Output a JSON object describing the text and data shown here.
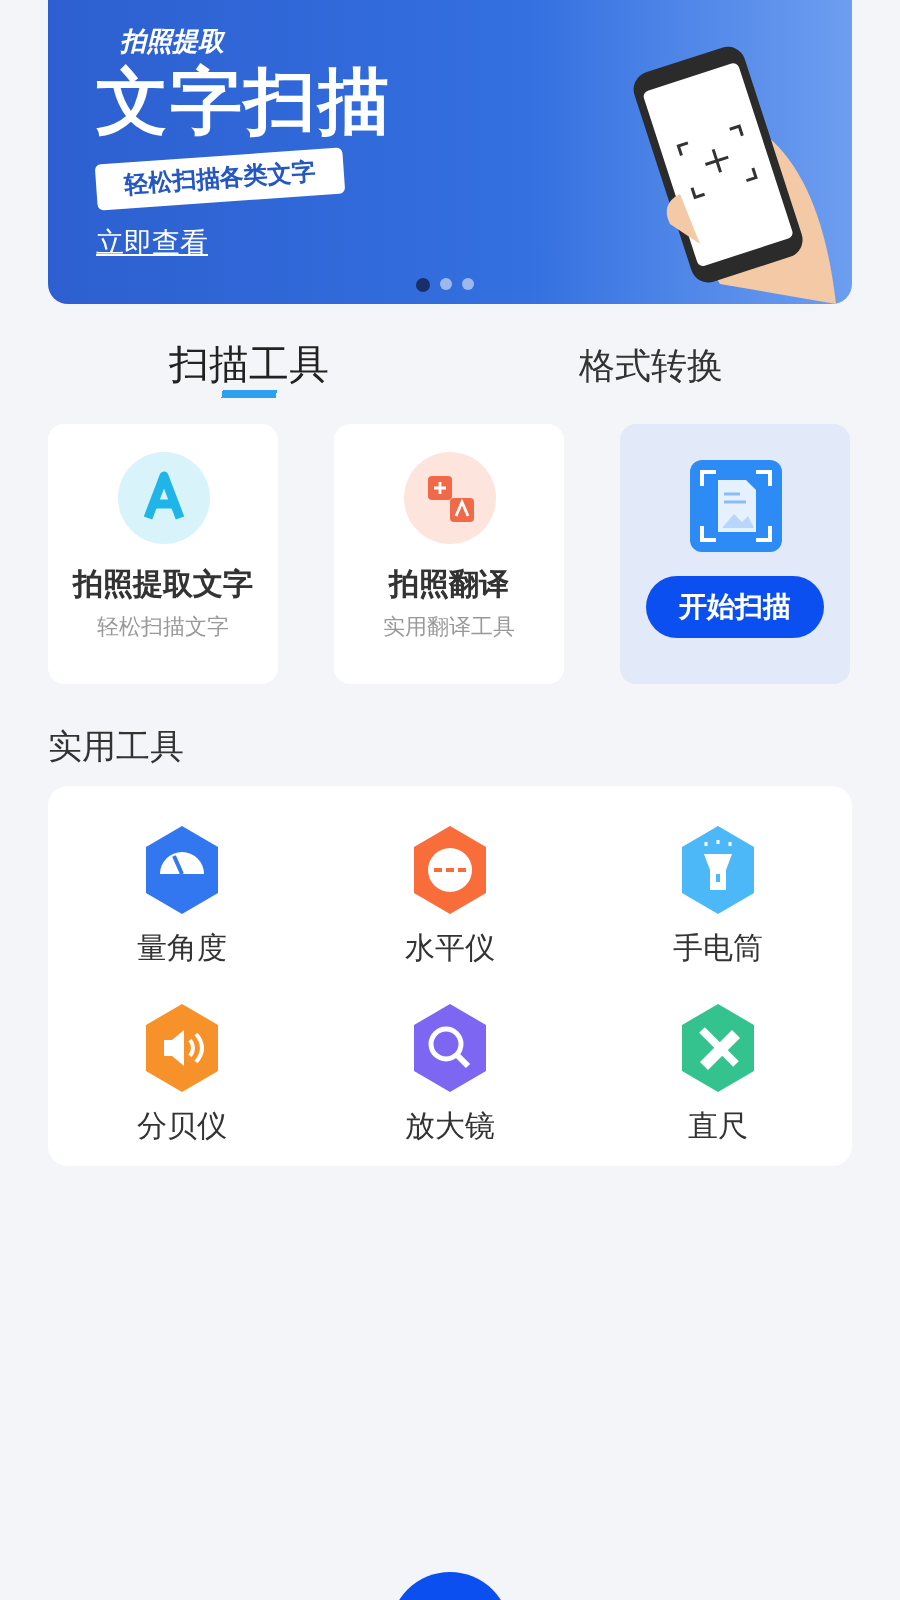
{
  "banner": {
    "tag": "拍照提取",
    "headline": "文字扫描",
    "subtitle": "轻松扫描各类文字",
    "link": "立即查看",
    "dots": [
      {
        "selected": true
      },
      {
        "selected": false
      },
      {
        "selected": false
      }
    ]
  },
  "tabs": [
    {
      "label": "扫描工具",
      "selected": true
    },
    {
      "label": "格式转换",
      "selected": false
    }
  ],
  "features": [
    {
      "kind": "text",
      "title": "拍照提取文字",
      "subtitle": "轻松扫描文字"
    },
    {
      "kind": "translate",
      "title": "拍照翻译",
      "subtitle": "实用翻译工具"
    }
  ],
  "scan_card": {
    "button": "开始扫描"
  },
  "tools_section": {
    "title": "实用工具",
    "tools": [
      {
        "kind": "protractor",
        "label": "量角度",
        "color": "#3377f0"
      },
      {
        "kind": "level",
        "label": "水平仪",
        "color": "#f86d3a"
      },
      {
        "kind": "flashlight",
        "label": "手电筒",
        "color": "#4cb8f7"
      },
      {
        "kind": "speaker",
        "label": "分贝仪",
        "color": "#f7922a"
      },
      {
        "kind": "magnifier",
        "label": "放大镜",
        "color": "#7c66f2"
      },
      {
        "kind": "ruler",
        "label": "直尺",
        "color": "#34c38f"
      }
    ]
  }
}
